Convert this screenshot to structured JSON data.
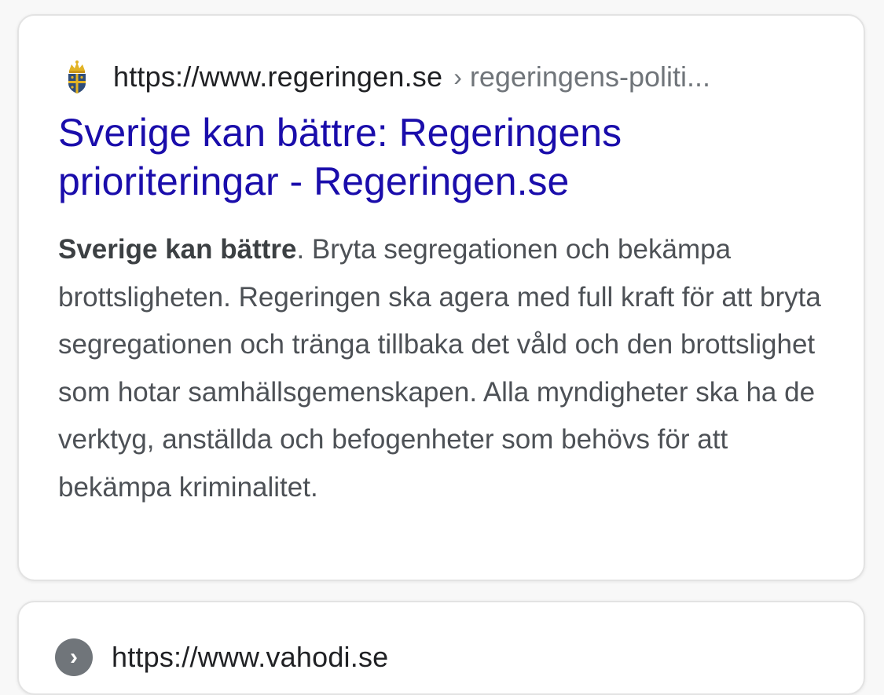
{
  "results": [
    {
      "favicon": "swedish-crown-shield-icon",
      "url_domain": "https://www.regeringen.se",
      "breadcrumb_separator": "›",
      "url_path": "regeringens-politi...",
      "title_line1": "Sverige kan bättre: Regeringens",
      "title_line2": "prioriteringar - Regeringen.se",
      "snippet_bold": "Sverige kan bättre",
      "snippet_rest": ". Bryta segregationen och bekämpa brottsligheten. Regeringen ska agera med full kraft för att bryta segregationen och tränga tillbaka det våld och den brottslighet som hotar samhällsgemenskapen. Alla myndigheter ska ha de verktyg, anställda och befogenheter som behövs för att bekämpa kriminalitet."
    },
    {
      "favicon": "chevron-right-circle-icon",
      "favicon_glyph": "›",
      "url_domain": "https://www.vahodi.se"
    }
  ],
  "colors": {
    "title_link": "#1a0dab",
    "snippet_text": "#4d5156",
    "url_gray": "#70757a"
  }
}
